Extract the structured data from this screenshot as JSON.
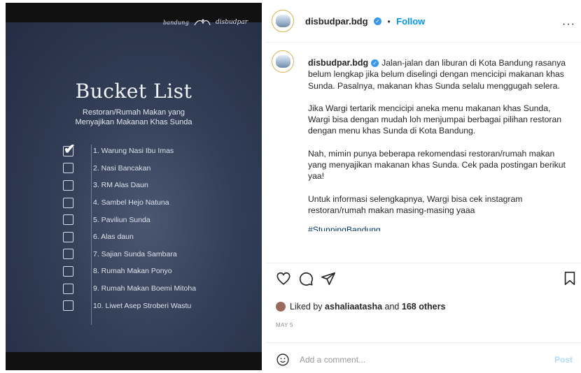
{
  "media": {
    "logo_left": "bandung",
    "logo_right": "disbudpar",
    "title": "Bucket List",
    "subtitle_line1": "Restoran/Rumah Makan yang",
    "subtitle_line2": "Menyajikan Makanan Khas Sunda",
    "items": [
      {
        "label": "1. Warung Nasi Ibu Imas",
        "checked": true
      },
      {
        "label": "2. Nasi Bancakan",
        "checked": false
      },
      {
        "label": "3. RM Alas Daun",
        "checked": false
      },
      {
        "label": "4. Sambel Hejo Natuna",
        "checked": false
      },
      {
        "label": "5. Paviliun Sunda",
        "checked": false
      },
      {
        "label": "6. Alas daun",
        "checked": false
      },
      {
        "label": "7. Sajian Sunda Sambara",
        "checked": false
      },
      {
        "label": "8. Rumah Makan Ponyo",
        "checked": false
      },
      {
        "label": "9. Rumah Makan Boemi Mitoha",
        "checked": false
      },
      {
        "label": "10. Liwet Asep Stroberi Wastu",
        "checked": false
      }
    ]
  },
  "header": {
    "username": "disbudpar.bdg",
    "separator": "•",
    "follow_label": "Follow",
    "more_label": "···"
  },
  "caption": {
    "username": "disbudpar.bdg",
    "para1": "Jalan-jalan dan liburan di Kota Bandung rasanya belum lengkap jika belum diselingi dengan mencicipi makanan khas Sunda. Pasalnya, makanan khas Sunda selalu menggugah selera.",
    "para2": "Jika Wargi tertarik mencicipi aneka menu makanan khas Sunda, Wargi bisa dengan mudah loh menjumpai berbagai pilihan restoran dengan menu khas Sunda di Kota Bandung.",
    "para3": "Nah, mimin punya beberapa rekomendasi restoran/rumah makan yang menyajikan makanan khas Sunda. Cek pada postingan berikut yaa!",
    "para4": "Untuk informasi selengkapnya, Wargi bisa cek instagram restoran/rumah makan masing-masing yaaa",
    "hashtag": "#StunningBandung"
  },
  "engagement": {
    "liked_prefix": "Liked by",
    "liked_user": "ashaliaatasha",
    "liked_and": "and",
    "liked_others": "168 others",
    "date": "MAY 5"
  },
  "comment": {
    "placeholder": "Add a comment...",
    "post_label": "Post"
  },
  "colors": {
    "accent": "#0095f6",
    "verified": "#3897f0",
    "media_bg": "#2e3a52"
  }
}
